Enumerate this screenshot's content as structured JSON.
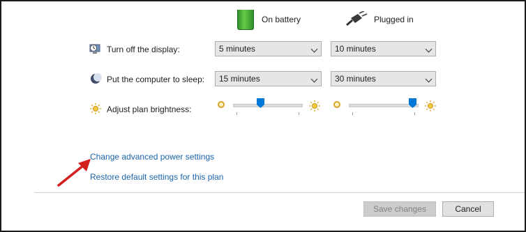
{
  "columns": {
    "on_battery": "On battery",
    "plugged_in": "Plugged in"
  },
  "settings": {
    "display": {
      "label": "Turn off the display:",
      "battery_value": "5 minutes",
      "plugged_value": "10 minutes"
    },
    "sleep": {
      "label": "Put the computer to sleep:",
      "battery_value": "15 minutes",
      "plugged_value": "30 minutes"
    },
    "brightness": {
      "label": "Adjust plan brightness:",
      "battery_level": 0.4,
      "plugged_level": 0.93
    }
  },
  "links": {
    "advanced": "Change advanced power settings",
    "restore": "Restore default settings for this plan"
  },
  "buttons": {
    "save": "Save changes",
    "cancel": "Cancel"
  },
  "colors": {
    "accent": "#0078d7",
    "link": "#1a64ab",
    "annotation_arrow": "#d41f1f"
  }
}
